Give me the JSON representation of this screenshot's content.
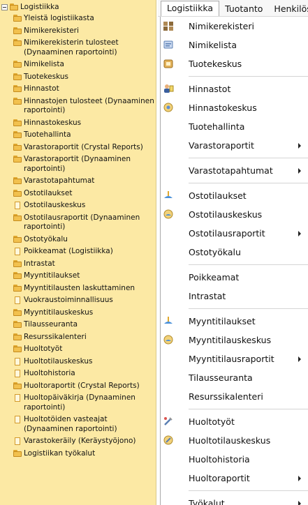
{
  "menubar": {
    "items": [
      "Logistiikka",
      "Tuotanto",
      "Henkilöstö"
    ]
  },
  "tree": {
    "root_label": "Logistiikka",
    "items": [
      {
        "label": "Yleistä logistiikasta",
        "icon": "folder-icon"
      },
      {
        "label": "Nimikerekisteri",
        "icon": "folder-icon"
      },
      {
        "label": "Nimikerekisterin tulosteet\n(Dynaaminen raportointi)",
        "icon": "folder-icon"
      },
      {
        "label": "Nimikelista",
        "icon": "folder-icon"
      },
      {
        "label": "Tuotekeskus",
        "icon": "folder-icon"
      },
      {
        "label": "Hinnastot",
        "icon": "folder-icon"
      },
      {
        "label": "Hinnastojen tulosteet (Dynaaminen\nraportointi)",
        "icon": "folder-icon"
      },
      {
        "label": "Hinnastokeskus",
        "icon": "folder-icon"
      },
      {
        "label": "Tuotehallinta",
        "icon": "folder-icon"
      },
      {
        "label": "Varastoraportit (Crystal Reports)",
        "icon": "folder-icon"
      },
      {
        "label": "Varastoraportit (Dynaaminen\nraportointi)",
        "icon": "folder-icon"
      },
      {
        "label": "Varastotapahtumat",
        "icon": "folder-icon"
      },
      {
        "label": "Ostotilaukset",
        "icon": "folder-icon"
      },
      {
        "label": "Ostotilauskeskus",
        "icon": "document-icon"
      },
      {
        "label": "Ostotilausraportit (Dynaaminen\nraportointi)",
        "icon": "folder-icon"
      },
      {
        "label": "Ostotyökalu",
        "icon": "folder-icon"
      },
      {
        "label": "Poikkeamat (Logistiikka)",
        "icon": "document-icon"
      },
      {
        "label": "Intrastat",
        "icon": "folder-icon"
      },
      {
        "label": "Myyntitilaukset",
        "icon": "folder-icon"
      },
      {
        "label": "Myyntitilausten laskuttaminen",
        "icon": "folder-icon"
      },
      {
        "label": "Vuokraustoiminnallisuus",
        "icon": "document-icon"
      },
      {
        "label": "Myyntitilauskeskus",
        "icon": "folder-icon"
      },
      {
        "label": "Tilausseuranta",
        "icon": "folder-icon"
      },
      {
        "label": "Resurssikalenteri",
        "icon": "folder-icon"
      },
      {
        "label": "Huoltotyöt",
        "icon": "folder-icon"
      },
      {
        "label": "Huoltotilauskeskus",
        "icon": "document-icon"
      },
      {
        "label": "Huoltohistoria",
        "icon": "document-icon"
      },
      {
        "label": "Huoltoraportit (Crystal Reports)",
        "icon": "folder-icon"
      },
      {
        "label": "Huoltopäiväkirja (Dynaaminen\nraportointi)",
        "icon": "document-icon"
      },
      {
        "label": "Huoltotöiden vasteajat\n(Dynaaminen raportointi)",
        "icon": "document-icon"
      },
      {
        "label": "Varastokeräily (Keräystyöjono)",
        "icon": "document-icon"
      },
      {
        "label": "Logistiikan työkalut",
        "icon": "folder-icon"
      }
    ]
  },
  "dropdown": {
    "groups": [
      [
        {
          "label": "Nimikerekisteri",
          "icon": "item-registry-icon",
          "submenu": false
        },
        {
          "label": "Nimikelista",
          "icon": "item-list-icon",
          "submenu": false
        },
        {
          "label": "Tuotekeskus",
          "icon": "product-center-icon",
          "submenu": false
        }
      ],
      [
        {
          "label": "Hinnastot",
          "icon": "price-list-icon",
          "submenu": false
        },
        {
          "label": "Hinnastokeskus",
          "icon": "price-center-icon",
          "submenu": false
        },
        {
          "label": "Tuotehallinta",
          "icon": "",
          "submenu": false
        },
        {
          "label": "Varastoraportit",
          "icon": "",
          "submenu": true
        }
      ],
      [
        {
          "label": "Varastotapahtumat",
          "icon": "",
          "submenu": true
        }
      ],
      [
        {
          "label": "Ostotilaukset",
          "icon": "purchase-order-icon",
          "submenu": false
        },
        {
          "label": "Ostotilauskeskus",
          "icon": "purchase-center-icon",
          "submenu": false
        },
        {
          "label": "Ostotilausraportit",
          "icon": "",
          "submenu": true
        },
        {
          "label": "Ostotyökalu",
          "icon": "",
          "submenu": false
        }
      ],
      [
        {
          "label": "Poikkeamat",
          "icon": "",
          "submenu": false
        },
        {
          "label": "Intrastat",
          "icon": "",
          "submenu": false
        }
      ],
      [
        {
          "label": "Myyntitilaukset",
          "icon": "sales-order-icon",
          "submenu": false
        },
        {
          "label": "Myyntitilauskeskus",
          "icon": "sales-center-icon",
          "submenu": false
        },
        {
          "label": "Myyntitilausraportit",
          "icon": "",
          "submenu": true
        },
        {
          "label": "Tilausseuranta",
          "icon": "",
          "submenu": false
        },
        {
          "label": "Resurssikalenteri",
          "icon": "",
          "submenu": false
        }
      ],
      [
        {
          "label": "Huoltotyöt",
          "icon": "service-work-icon",
          "submenu": false
        },
        {
          "label": "Huoltotilauskeskus",
          "icon": "service-center-icon",
          "submenu": false
        },
        {
          "label": "Huoltohistoria",
          "icon": "",
          "submenu": false
        },
        {
          "label": "Huoltoraportit",
          "icon": "",
          "submenu": true
        }
      ],
      [
        {
          "label": "Työkalut",
          "icon": "",
          "submenu": true
        }
      ]
    ]
  }
}
